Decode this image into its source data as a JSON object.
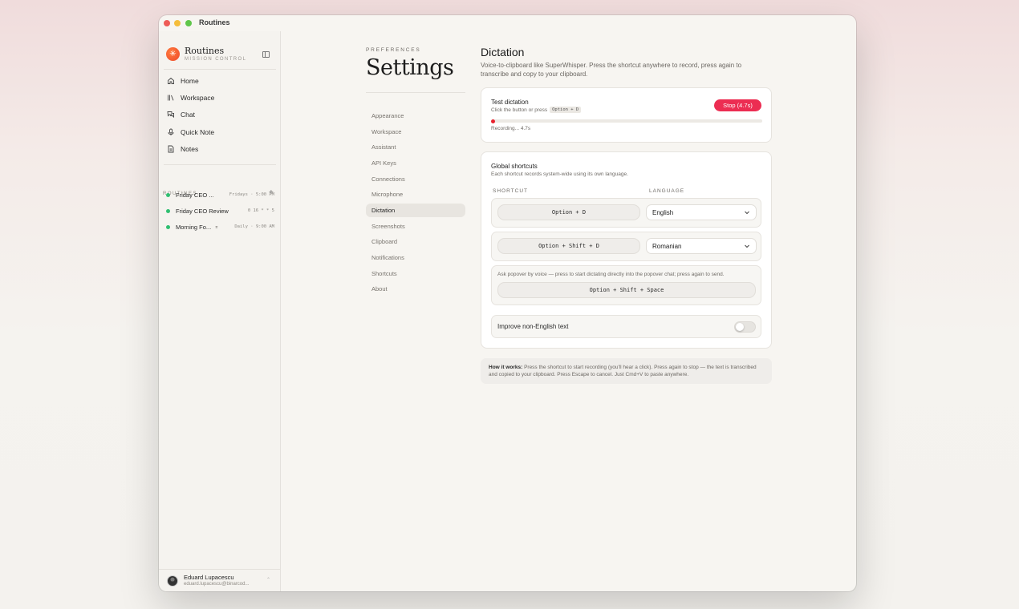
{
  "window": {
    "title": "Routines"
  },
  "brand": {
    "title": "Routines",
    "subtitle": "MISSION CONTROL"
  },
  "nav": {
    "items": [
      {
        "label": "Home",
        "icon": "home-icon"
      },
      {
        "label": "Workspace",
        "icon": "library-icon"
      },
      {
        "label": "Chat",
        "icon": "chat-icon"
      },
      {
        "label": "Quick Note",
        "icon": "microphone-icon"
      },
      {
        "label": "Notes",
        "icon": "document-icon"
      }
    ]
  },
  "routines": {
    "heading": "ROUTINES",
    "add_label": "+",
    "items": [
      {
        "name": "Friday CEO ...",
        "schedule": "Fridays · 5:00 PM",
        "status_color": "#2fbf71"
      },
      {
        "name": "Friday CEO Review",
        "schedule": "0 16 * * 5",
        "status_color": "#2fbf71"
      },
      {
        "name": "Morning Fo...",
        "schedule": "Daily · 9:00 AM",
        "pinned_icon": "pin-icon",
        "status_color": "#2fbf71"
      }
    ]
  },
  "user": {
    "name": "Eduard Lupacescu",
    "email": "eduard.lupacescu@binarcod...",
    "caret": "⌃"
  },
  "settings": {
    "eyebrow": "PREFERENCES",
    "title": "Settings",
    "nav": [
      "Appearance",
      "Workspace",
      "Assistant",
      "API Keys",
      "Connections",
      "Microphone",
      "Dictation",
      "Screenshots",
      "Clipboard",
      "Notifications",
      "Shortcuts",
      "About"
    ],
    "active": "Dictation"
  },
  "dictation": {
    "title": "Dictation",
    "description": "Voice-to-clipboard like SuperWhisper. Press the shortcut anywhere to record, press again to transcribe and copy to your clipboard.",
    "test": {
      "title": "Test dictation",
      "hint": "Click the button or press",
      "hint_key": "Option + D",
      "stop_label": "Stop (4.7s)",
      "status": "Recording... 4.7s",
      "accent": "#ec2d52"
    },
    "global": {
      "title": "Global shortcuts",
      "description": "Each shortcut records system-wide using its own language.",
      "col_shortcut": "SHORTCUT",
      "col_language": "LANGUAGE",
      "rows": [
        {
          "shortcut": "Option + D",
          "language": "English"
        },
        {
          "shortcut": "Option + Shift + D",
          "language": "Romanian"
        }
      ],
      "popover": {
        "description": "Ask popover by voice — press to start dictating directly into the popover chat; press again to send.",
        "shortcut": "Option + Shift + Space"
      },
      "improve": {
        "label": "Improve non-English text",
        "enabled": false
      }
    },
    "how": {
      "label": "How it works:",
      "text": " Press the shortcut to start recording (you'll hear a click). Press again to stop — the text is transcribed and copied to your clipboard. Press Escape to cancel. Just Cmd+V to paste anywhere."
    }
  }
}
